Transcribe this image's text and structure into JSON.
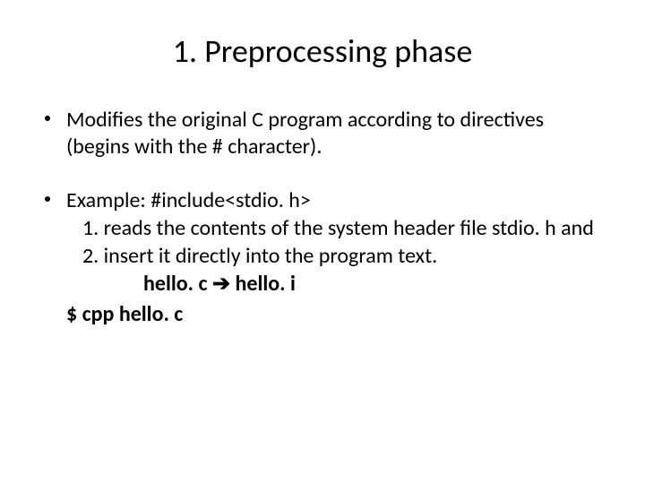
{
  "title": "1. Preprocessing phase",
  "b1": "Modifies the original C program according to directives (begins with the # character).",
  "b2": "Example: #include<stdio. h>",
  "s1": "1. reads the contents of the system header file stdio. h and",
  "s2": "2. insert it directly into the program text.",
  "file_from": "hello. c",
  "arrow": "➔",
  "file_to": "hello. i",
  "cmd": "$ cpp hello. c"
}
